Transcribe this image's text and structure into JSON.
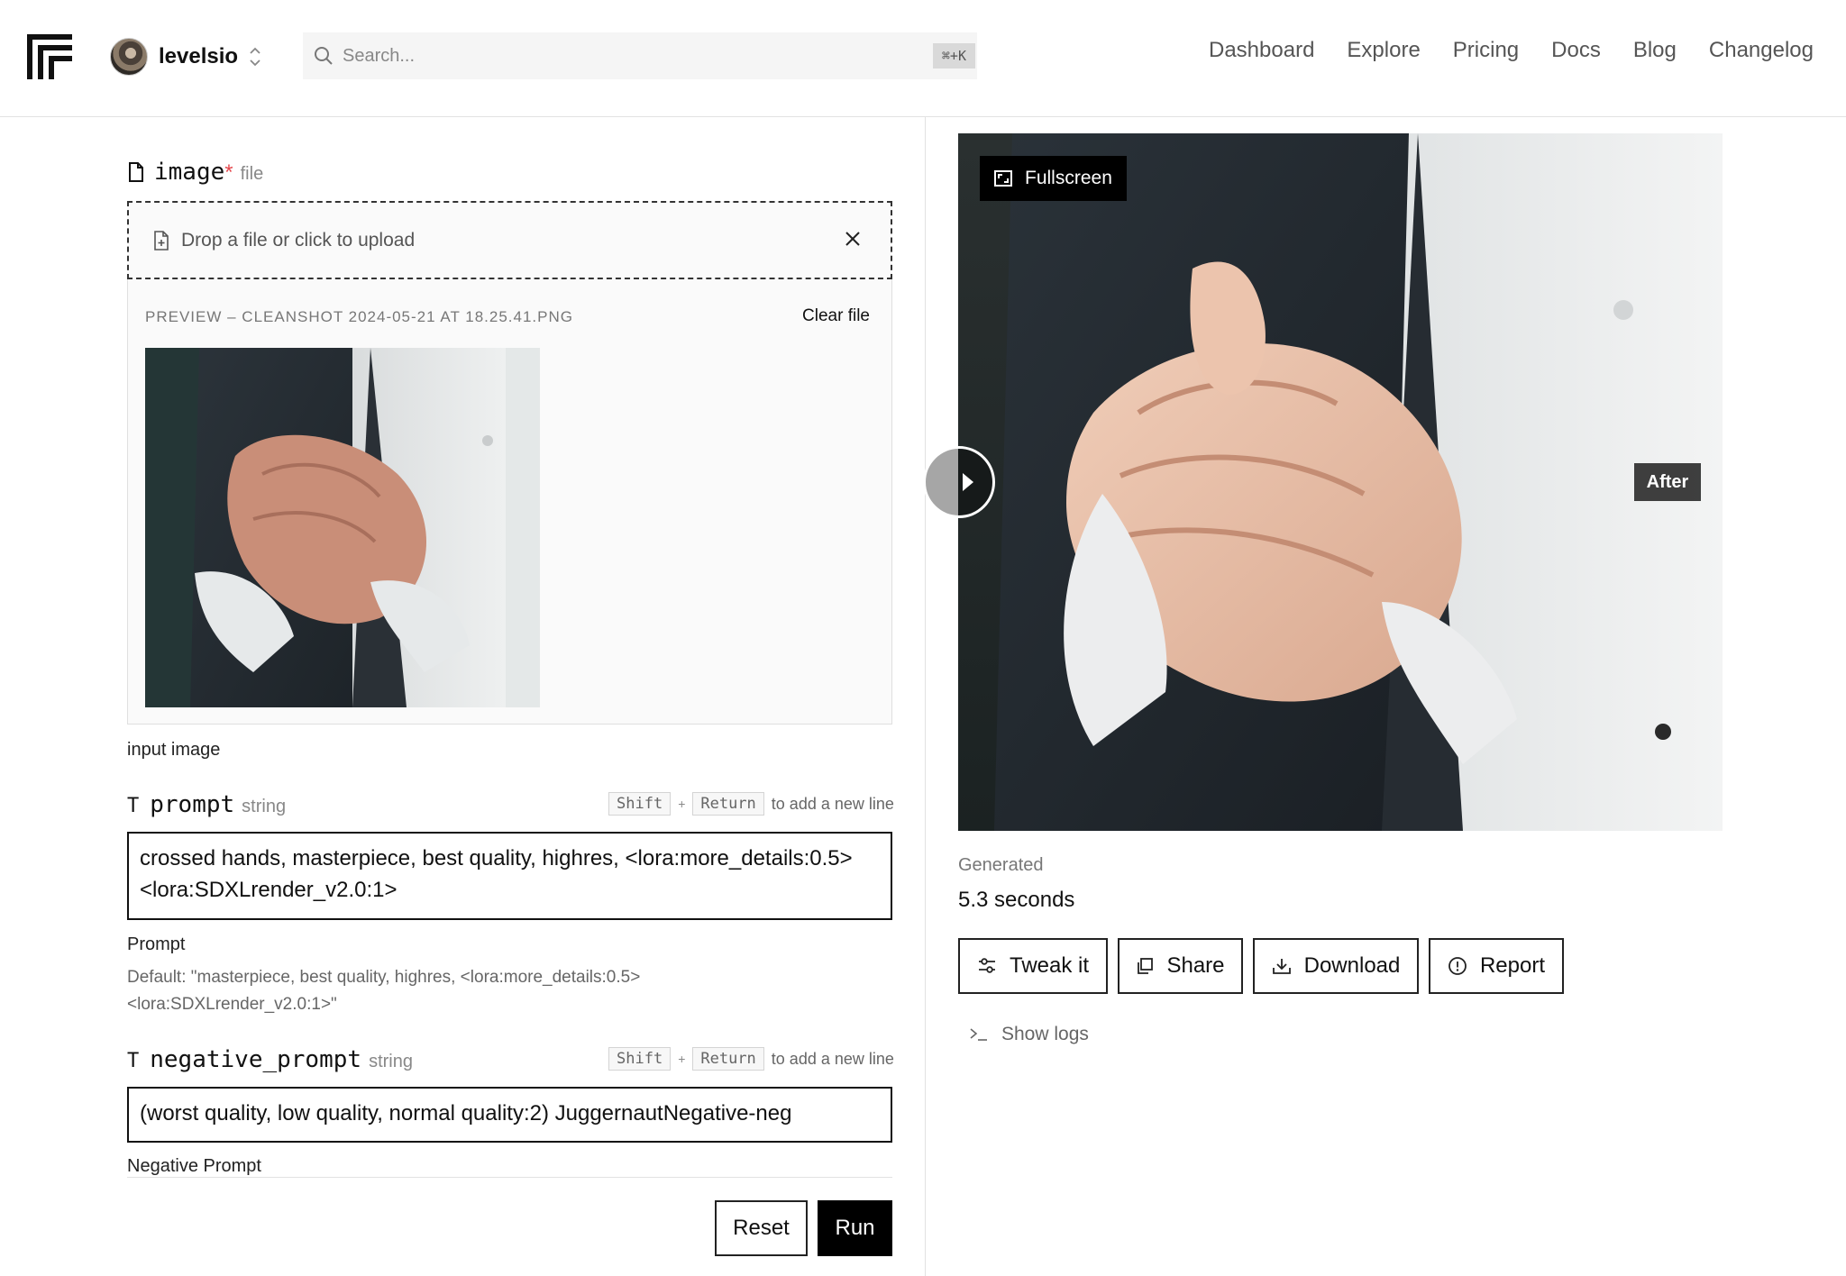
{
  "header": {
    "username": "levelsio",
    "search_placeholder": "Search...",
    "search_shortcut": "⌘+K",
    "nav": [
      "Dashboard",
      "Explore",
      "Pricing",
      "Docs",
      "Blog",
      "Changelog"
    ]
  },
  "image_field": {
    "name": "image",
    "required_mark": "*",
    "type": "file",
    "drop_text": "Drop a file or click to upload",
    "preview_label": "Preview – CleanShot 2024-05-21 at 18.25.41.png",
    "clear_label": "Clear file",
    "description": "input image"
  },
  "prompt_field": {
    "name": "prompt",
    "type": "string",
    "hint_key1": "Shift",
    "hint_plus": "+",
    "hint_key2": "Return",
    "hint_text": "to add a new line",
    "value": "crossed hands, masterpiece, best quality, highres, <lora:more_details:0.5> <lora:SDXLrender_v2.0:1>",
    "description": "Prompt",
    "default_text": "Default: \"masterpiece, best quality, highres, <lora:more_details:0.5> <lora:SDXLrender_v2.0:1>\""
  },
  "negative_prompt_field": {
    "name": "negative_prompt",
    "type": "string",
    "hint_key1": "Shift",
    "hint_plus": "+",
    "hint_key2": "Return",
    "hint_text": "to add a new line",
    "value": "(worst quality, low quality, normal quality:2) JuggernautNegative-neg",
    "description": "Negative Prompt"
  },
  "form_actions": {
    "reset": "Reset",
    "run": "Run"
  },
  "result": {
    "fullscreen": "Fullscreen",
    "after_badge": "After",
    "generated_label": "Generated",
    "generated_value": "5.3 seconds",
    "actions": [
      "Tweak it",
      "Share",
      "Download",
      "Report"
    ],
    "show_logs": "Show logs"
  }
}
